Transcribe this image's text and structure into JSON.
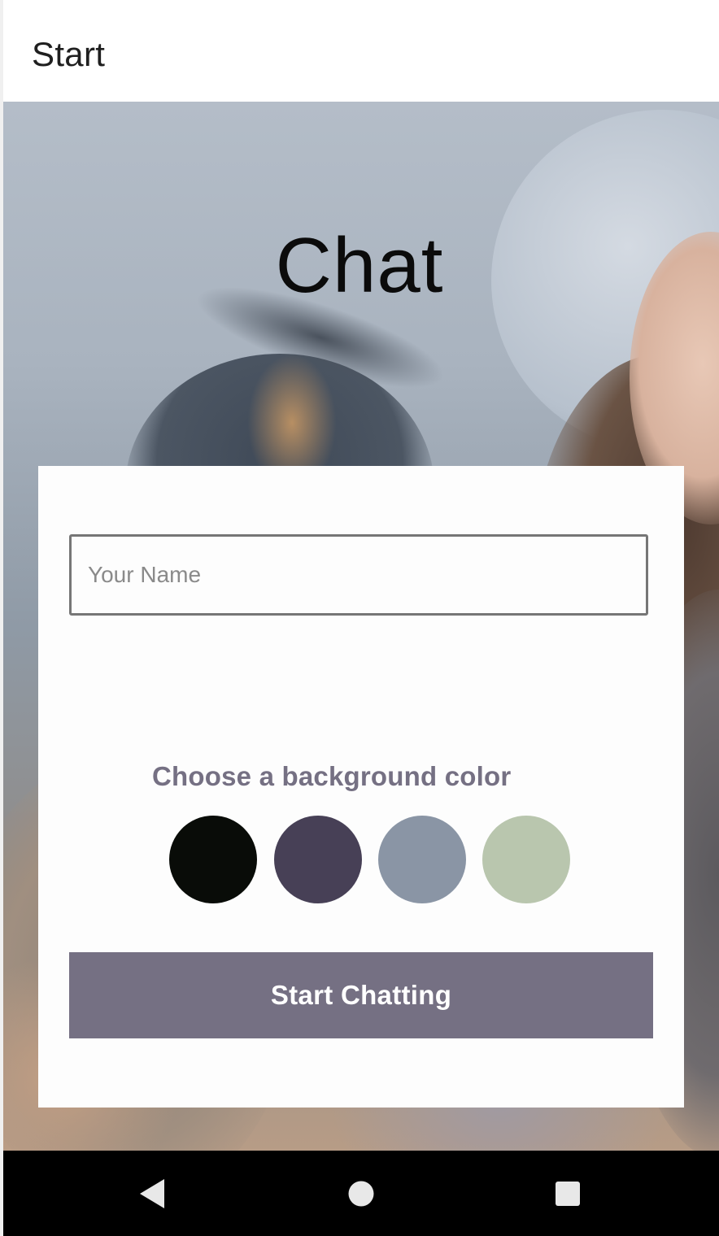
{
  "app_bar": {
    "title": "Start"
  },
  "hero": {
    "title": "Chat"
  },
  "form": {
    "name_placeholder": "Your Name",
    "name_value": "",
    "color_label": "Choose a background color",
    "colors": [
      {
        "name": "black",
        "hex": "#090C08"
      },
      {
        "name": "dark-purple",
        "hex": "#474056"
      },
      {
        "name": "gray-blue",
        "hex": "#8A95A5"
      },
      {
        "name": "sage-green",
        "hex": "#B9C6AE"
      }
    ],
    "submit_label": "Start Chatting",
    "submit_color": "#757083"
  },
  "nav_bar": {
    "icons": [
      "back-icon",
      "home-icon",
      "recents-icon"
    ]
  }
}
